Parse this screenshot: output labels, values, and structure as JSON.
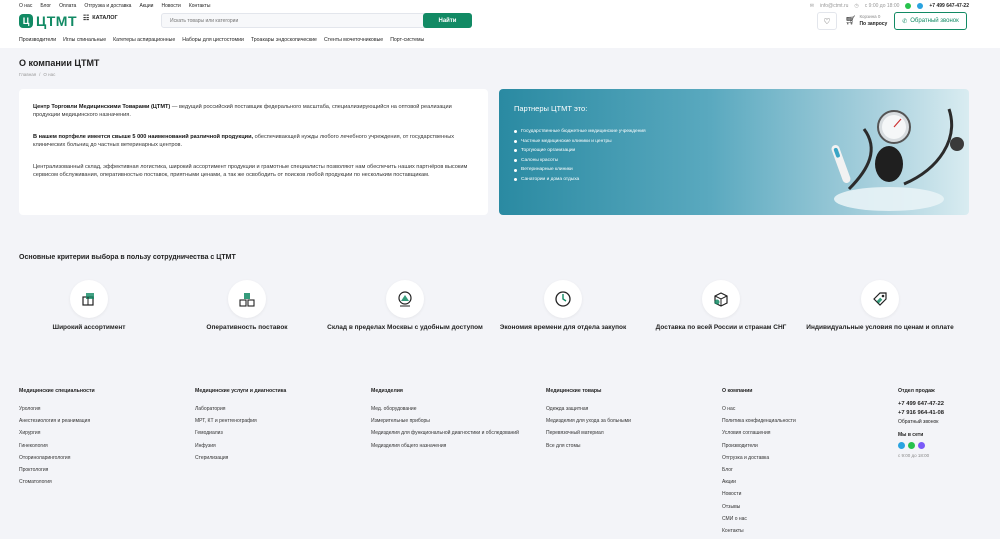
{
  "topnav": [
    "О нас",
    "Блог",
    "Оплата",
    "Отгрузка и доставка",
    "Акции",
    "Новости",
    "Контакты"
  ],
  "topright": {
    "email": "info@ctmt.ru",
    "hours": "с 9:00 до 18:00",
    "phone": "+7 499 647-47-22"
  },
  "logo": {
    "mark": "Ц",
    "text": "ЦТМТ"
  },
  "catalog_label": "КАТАЛОГ",
  "search": {
    "placeholder": "Искать товары или категории",
    "button": "Найти"
  },
  "cart": {
    "count": "Корзина 0",
    "label": "По запросу"
  },
  "callback_label": "Обратный звонок",
  "catnav": [
    "Производители",
    "Иглы спинальные",
    "Катетеры аспирационные",
    "Наборы для цистостомии",
    "Троакары эндоскопические",
    "Стенты мочеточниковые",
    "Порт-системы"
  ],
  "page": {
    "title": "О компании ЦТМТ",
    "breadcrumb": [
      "Главная",
      "/",
      "О нас"
    ]
  },
  "about": {
    "p1_bold": "Центр Торговли Медицинскими Товарами (ЦТМТ)",
    "p1_rest": " — ведущий российский поставщик федерального масштаба, специализирующийся на оптовой реализации продукции медицинского назначения.",
    "p2_bold": "В нашем портфеле имеется свыше 5 000 наименований различной продукции,",
    "p2_rest": " обеспечивающей нужды любого лечебного учреждения, от государственных клинических больниц до частных ветеринарных центров.",
    "p3": "Централизованный склад, эффективная логистика, широкий ассортимент продукции и грамотные специалисты позволяют нам обеспечить наших партнёров высоким сервисом обслуживания, оперативностью поставок, приятными ценами, а так же освободить от поисков любой продукции по нескольким поставщикам."
  },
  "partners": {
    "title": "Партнеры ЦТМТ это:",
    "items": [
      "Государственные бюджетные медицинские учреждения",
      "Частные медицинские клиники и центры",
      "Торгующие организации",
      "Салоны красоты",
      "Ветеринарные клиники",
      "Санатории и дома отдыха"
    ]
  },
  "criteria": {
    "title": "Основные критерии выбора в пользу сотрудничества с ЦТМТ",
    "items": [
      {
        "label": "Широкий ассортимент",
        "icon": "boxes-icon"
      },
      {
        "label": "Оперативность поставок",
        "icon": "stacked-boxes-icon"
      },
      {
        "label": "Склад в пределах Москвы с удобным доступом",
        "icon": "map-pin-icon"
      },
      {
        "label": "Экономия времени для отдела закупок",
        "icon": "clock-icon"
      },
      {
        "label": "Доставка по всей России и странам СНГ",
        "icon": "parcel-icon"
      },
      {
        "label": "Индивидуальные условия по ценам и оплате",
        "icon": "price-tag-icon"
      }
    ]
  },
  "footer": {
    "cols": [
      {
        "title": "Медицинские специальности",
        "items": [
          "Урология",
          "Анестезиология и реанимация",
          "Хирургия",
          "Гинекология",
          "Оториноларингология",
          "Проктология",
          "Стоматология"
        ]
      },
      {
        "title": "Медицинские услуги и диагностика",
        "items": [
          "Лаборатория",
          "МРТ, КТ и рентгенография",
          "Гемодиализ",
          "Инфузия",
          "Стерилизация"
        ]
      },
      {
        "title": "Медизделия",
        "items": [
          "Мед. оборудование",
          "Измерительные приборы",
          "Медизделия для функциональной диагностики и обследований",
          "Медизделия общего назначения"
        ]
      },
      {
        "title": "Медицинские товары",
        "items": [
          "Одежда защитная",
          "Медизделия для ухода за больными",
          "Перевязочный материал",
          "Все для стомы"
        ]
      },
      {
        "title": "О компании",
        "items": [
          "О нас",
          "Политика конфиденциальности",
          "Условия соглашения",
          "Производители",
          "Отгрузка и доставка",
          "Блог",
          "Акции",
          "Новости",
          "Отзывы",
          "СМИ о нас",
          "Контакты"
        ]
      }
    ],
    "sales": {
      "title": "Отдел продаж",
      "phones": [
        "+7 499 647-47-22",
        "+7 916 964-41-08"
      ],
      "callback": "Обратный звонок",
      "social_title": "Мы в сети",
      "hours": "с 9:00 до 18:00"
    }
  },
  "colors": {
    "accent": "#128a64",
    "partners_bg": "#3c93aa"
  }
}
